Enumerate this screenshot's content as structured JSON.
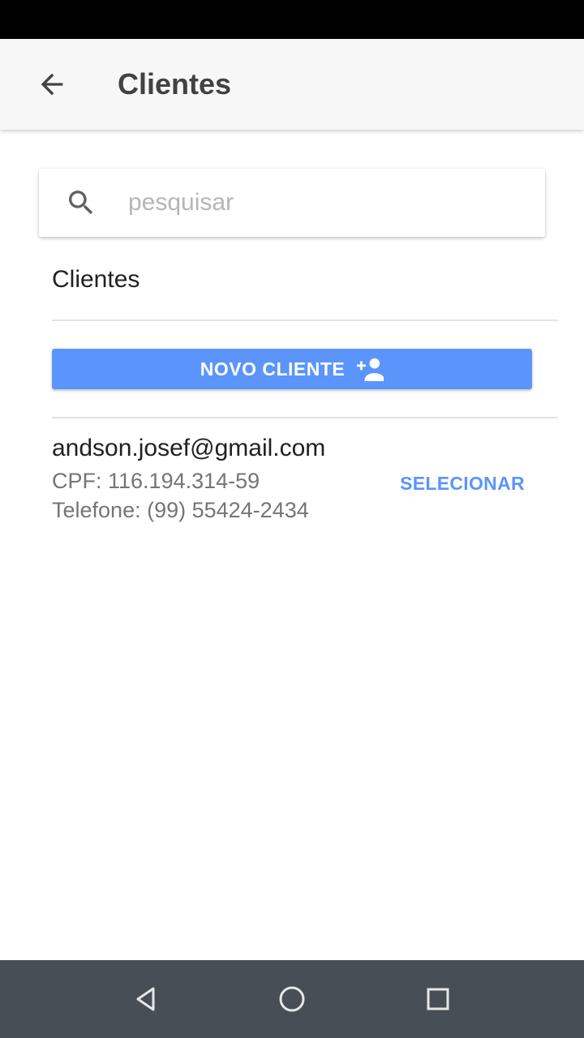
{
  "app_bar": {
    "title": "Clientes",
    "back_icon": "arrow-left-icon"
  },
  "search": {
    "placeholder": "pesquisar",
    "value": "",
    "icon": "search-icon"
  },
  "section": {
    "title": "Clientes"
  },
  "new_client_button": {
    "label": "NOVO CLIENTE",
    "icon": "person-add-icon"
  },
  "clients": [
    {
      "email": "andson.josef@gmail.com",
      "cpf": "CPF: 116.194.314-59",
      "phone": "Telefone: (99) 55424-2434",
      "select_label": "SELECIONAR"
    }
  ],
  "nav_bar": {
    "back": "triangle-back-icon",
    "home": "circle-home-icon",
    "recents": "square-recents-icon"
  },
  "colors": {
    "accent": "#5b95fb",
    "app_bar_bg": "#f7f7f7",
    "nav_bar_bg": "#474e55",
    "status_bar_bg": "#000000"
  }
}
